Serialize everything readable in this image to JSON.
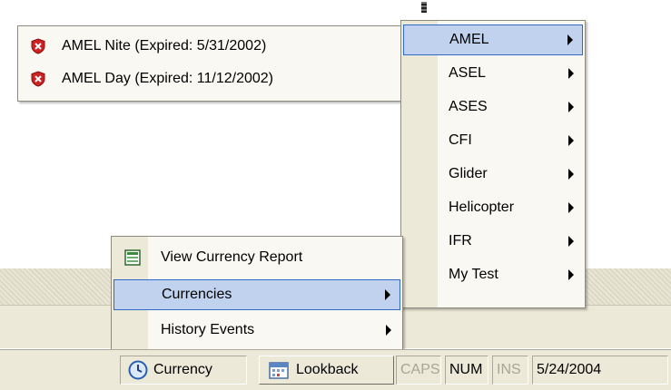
{
  "expired_menu": {
    "items": [
      {
        "label": "AMEL Nite (Expired: 5/31/2002)",
        "icon": "expired-shield-icon"
      },
      {
        "label": "AMEL Day (Expired: 11/12/2002)",
        "icon": "expired-shield-icon"
      }
    ]
  },
  "category_menu": {
    "items": [
      {
        "label": "AMEL",
        "selected": true
      },
      {
        "label": "ASEL"
      },
      {
        "label": "ASES"
      },
      {
        "label": "CFI"
      },
      {
        "label": "Glider"
      },
      {
        "label": "Helicopter"
      },
      {
        "label": "IFR"
      },
      {
        "label": "My Test"
      }
    ]
  },
  "currency_menu": {
    "items": [
      {
        "label": "View Currency Report",
        "icon": "report-icon",
        "has_submenu": false
      },
      {
        "label": "Currencies",
        "has_submenu": true,
        "selected": true
      },
      {
        "label": "History Events",
        "has_submenu": true
      }
    ]
  },
  "status_bar": {
    "currency_button": "Currency",
    "lookback_button": "Lookback",
    "caps": "CAPS",
    "num": "NUM",
    "ins": "INS",
    "date": "5/24/2004"
  },
  "colors": {
    "menu_bg": "#f9f8f3",
    "gutter": "#ece9d8",
    "highlight_bg": "#c1d2ee",
    "highlight_border": "#316ac5",
    "expired_icon": "#cc2222"
  }
}
